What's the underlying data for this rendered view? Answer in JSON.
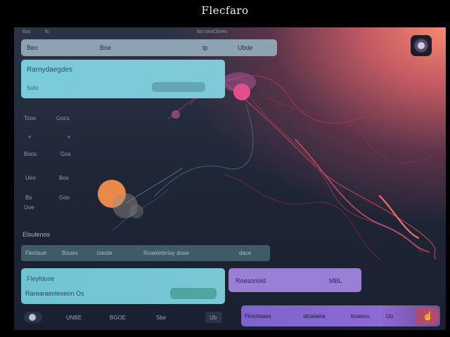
{
  "app": {
    "title": "Flecfaro"
  },
  "top_strip": {
    "left": "ttos",
    "left2": "fs",
    "center": "ttct ceoCbneo"
  },
  "toolbar": {
    "item1": "Beo",
    "item2": "Boe",
    "item3": "tp",
    "item4": "Ubde"
  },
  "card_top": {
    "title": "Rarnydaegdes",
    "subtitle": "Sofo"
  },
  "side_list": {
    "row1_a": "Toos",
    "row1_b": "Gocs",
    "row2_a": "Boos",
    "row2_b": "Gos",
    "row3_a": "Ueo",
    "row3_b": "Bos",
    "row4_a": "Bs",
    "row4_b": "Goo",
    "row5_a": "Uoe"
  },
  "section": {
    "heading": "Elsulenos"
  },
  "field_row": {
    "f1": "Fleclaue",
    "f2": "Boues",
    "f3": "toeste",
    "f4": "Roaeleteriay doae",
    "f5": "dace"
  },
  "card_bottom": {
    "title": "Fleyfdooe",
    "subtitle": "Rarearaeoleoeon Os"
  },
  "purple_button": {
    "left": "Roesoriold",
    "right": "MBL"
  },
  "bottom_bar": {
    "b1": "UNBE",
    "b2": "BGOE",
    "b3": "Sbe",
    "b4": "Ub"
  },
  "purple_bar": {
    "p1": "Floortoaes",
    "p2": "alcaiaeia",
    "p3": "boaeou",
    "p4": "Uo"
  },
  "icons": {
    "avatar": "avatar-icon",
    "thumb": "thumb-icon",
    "toggle": "circle-icon"
  },
  "colors": {
    "accent_cyan": "#7fc9d8",
    "accent_purple": "#9b7ed8",
    "accent_pink": "#e24e8e",
    "accent_orange": "#e98a48"
  }
}
